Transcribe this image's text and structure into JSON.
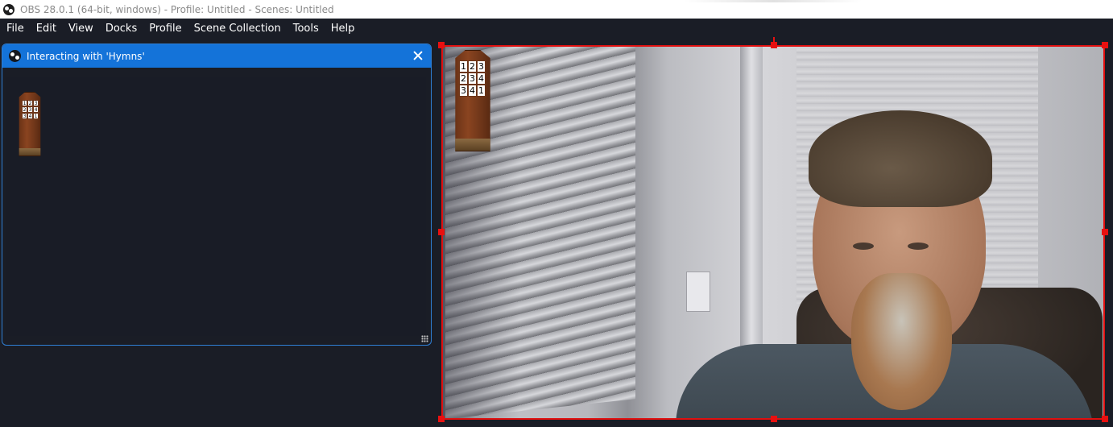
{
  "titlebar": {
    "text": "OBS 28.0.1 (64-bit, windows) - Profile: Untitled - Scenes: Untitled",
    "icon": "obs-logo-icon"
  },
  "menu": {
    "items": [
      "File",
      "Edit",
      "View",
      "Docks",
      "Profile",
      "Scene Collection",
      "Tools",
      "Help"
    ]
  },
  "dialog": {
    "title": "Interacting with 'Hymns'",
    "icon": "obs-logo-icon",
    "close_icon": "close-icon"
  },
  "hymn_board": {
    "rows": [
      [
        "1",
        "2",
        "3"
      ],
      [
        "2",
        "3",
        "4"
      ],
      [
        "3",
        "4",
        "1"
      ]
    ]
  },
  "colors": {
    "accent": "#1473d9",
    "selection": "#e01010",
    "background": "#1a1d26"
  }
}
